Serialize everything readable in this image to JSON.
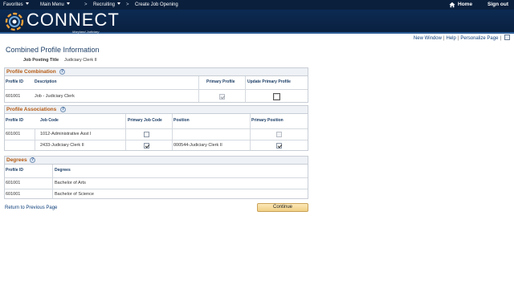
{
  "topnav": {
    "favorites": "Favorites",
    "main_menu": "Main Menu",
    "breadcrumb_sep1": ">",
    "recruiting": "Recruiting",
    "breadcrumb_sep2": ">",
    "create_job_opening": "Create Job Opening",
    "home": "Home",
    "sign_out": "Sign out"
  },
  "brand": {
    "name": "CONNECT",
    "subtitle": "Maryland Judiciary"
  },
  "pagelinks": {
    "new_window": "New Window",
    "sep1": "|",
    "help": "Help",
    "sep2": "|",
    "personalize": "Personalize Page",
    "sep3": "|"
  },
  "page": {
    "title": "Combined Profile Information",
    "job_posting_label": "Job Posting Title",
    "job_posting_value": "Judiciary Clerk II"
  },
  "profile_combination": {
    "title": "Profile Combination",
    "columns": [
      "Profile ID",
      "Description",
      "Primary Profile",
      "Update Primary Profile"
    ],
    "rows": [
      {
        "profile_id": "601001",
        "description": "Job - Judiciary Clerk",
        "primary_profile": true,
        "update_primary": false
      }
    ]
  },
  "profile_associations": {
    "title": "Profile Associations",
    "columns": [
      "Profile ID",
      "Job Code",
      "Primary Job Code",
      "Position",
      "Primary Position"
    ],
    "rows": [
      {
        "profile_id": "601001",
        "job_code": "1012-Administrative Asst I",
        "primary_job_code": false,
        "position": "",
        "primary_position": false
      },
      {
        "profile_id": "",
        "job_code": "2433-Judiciary Clerk II",
        "primary_job_code": true,
        "position": "000544-Judiciary Clerk II",
        "primary_position": true
      }
    ]
  },
  "degrees": {
    "title": "Degrees",
    "columns": [
      "Profile ID",
      "Degrees"
    ],
    "rows": [
      {
        "profile_id": "601001",
        "degree": "Bachelor of Arts"
      },
      {
        "profile_id": "601001",
        "degree": "Bachelor of Science"
      }
    ]
  },
  "actions": {
    "return_link": "Return to Previous Page",
    "continue": "Continue"
  },
  "colors": {
    "nav_bg": "#0a1f3c",
    "section_title": "#b55a12",
    "link": "#0d3e7a",
    "button": "#f0cf84"
  }
}
